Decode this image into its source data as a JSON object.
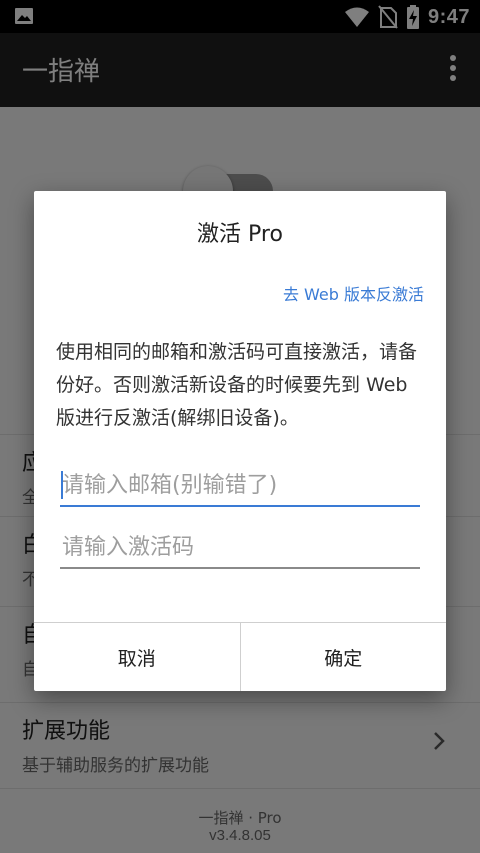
{
  "status_bar": {
    "time": "9:47"
  },
  "app_bar": {
    "title": "一指禅"
  },
  "background_rows": [
    {
      "title": "应",
      "subtitle": "全"
    },
    {
      "title": "白",
      "subtitle": "不"
    },
    {
      "title": "自",
      "subtitle": "自"
    },
    {
      "title": "扩展功能",
      "subtitle": "基于辅助服务的扩展功能"
    }
  ],
  "footer": {
    "name": "一指禅 · Pro",
    "version": "v3.4.8.05"
  },
  "dialog": {
    "title": "激活 Pro",
    "web_link": "去 Web 版本反激活",
    "message": "使用相同的邮箱和激活码可直接激活，请备份好。否则激活新设备的时候要先到 Web 版进行反激活(解绑旧设备)。",
    "email_placeholder": "请输入邮箱(别输错了)",
    "email_value": "",
    "code_placeholder": "请输入激活码",
    "code_value": "",
    "cancel_label": "取消",
    "confirm_label": "确定"
  }
}
